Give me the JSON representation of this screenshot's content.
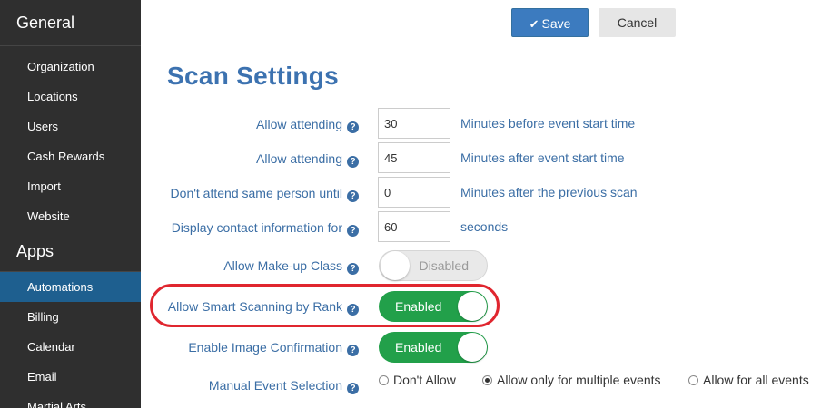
{
  "sidebar": {
    "general_header": "General",
    "general_items": [
      {
        "label": "Organization"
      },
      {
        "label": "Locations"
      },
      {
        "label": "Users"
      },
      {
        "label": "Cash Rewards"
      },
      {
        "label": "Import"
      },
      {
        "label": "Website"
      }
    ],
    "apps_header": "Apps",
    "apps_items": [
      {
        "label": "Automations",
        "active": true
      },
      {
        "label": "Billing"
      },
      {
        "label": "Calendar"
      },
      {
        "label": "Email"
      },
      {
        "label": "Martial Arts"
      }
    ]
  },
  "toolbar": {
    "save_label": "Save",
    "cancel_label": "Cancel"
  },
  "page": {
    "title": "Scan Settings"
  },
  "settings": {
    "rows": [
      {
        "label": "Allow attending",
        "value": "30",
        "unit": "Minutes before event start time"
      },
      {
        "label": "Allow attending",
        "value": "45",
        "unit": "Minutes after event start time"
      },
      {
        "label": "Don't attend same person until",
        "value": "0",
        "unit": "Minutes after the previous scan"
      },
      {
        "label": "Display contact information for",
        "value": "60",
        "unit": "seconds"
      }
    ],
    "makeup": {
      "label": "Allow Make-up Class",
      "state": "Disabled"
    },
    "smart_scan": {
      "label": "Allow Smart Scanning by Rank",
      "state": "Enabled"
    },
    "image_confirm": {
      "label": "Enable Image Confirmation",
      "state": "Enabled"
    },
    "manual_selection": {
      "label": "Manual Event Selection",
      "options": [
        "Don't Allow",
        "Allow only for multiple events",
        "Allow for all events"
      ],
      "selected": "Allow only for multiple events"
    }
  },
  "icons": {
    "help": "question-circle-icon",
    "save": "check-icon"
  },
  "colors": {
    "accent": "#3c72b0",
    "toggle_on": "#22a04a",
    "highlight": "#e0262f",
    "sidebar_active": "#1e5f8f"
  }
}
